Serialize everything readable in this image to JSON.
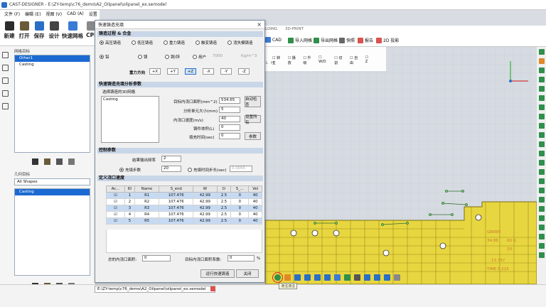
{
  "app": {
    "title": "CAST-DESIGNER - E:\\ZY-temp\\c76_demo\\A2_Oilpanel\\oilpanel_ex.semodel"
  },
  "menu": [
    "文件 (F)",
    "编辑 (E)",
    "视图 (V)",
    "CAD (A)",
    "设置"
  ],
  "toolbar": [
    {
      "label": "新建",
      "color": "#2d2d2d"
    },
    {
      "label": "打开",
      "color": "#6b5a3a"
    },
    {
      "label": "保存",
      "color": "#2a6fc6"
    },
    {
      "label": "设计",
      "color": "#444"
    },
    {
      "label": "快速网格",
      "color": "#3a7bd5"
    },
    {
      "label": "CPI",
      "color": "#888"
    }
  ],
  "ribbon": {
    "tabs": [
      "LDING",
      "3D-PRINT"
    ],
    "items": [
      "CAD",
      "导入网格",
      "导出网格",
      "快照",
      "报告",
      "2D 投影"
    ]
  },
  "left_panel": {
    "mesh_targets_label": "网格目标",
    "mesh_targets": [
      "Other1",
      "Casting"
    ],
    "geometry_targets_label": "几何目标",
    "filter": "All Shapes",
    "shapes": [
      "Casting"
    ]
  },
  "dialog": {
    "title": "快速铸造充填",
    "sec_process": "铸造过程 & 合金",
    "processes": [
      "高压铸造",
      "低压铸造",
      "重力铸造",
      "触变铸造",
      "消失模铸造"
    ],
    "alloys": [
      "铝",
      "镁",
      "铜/锌",
      "用户"
    ],
    "user_val": "7000",
    "user_unit": "Kg/m^3",
    "gravity_label": "重力方向",
    "dirs": [
      "+X",
      "+Y",
      "+Z",
      "-X",
      "-Y",
      "-Z"
    ],
    "sec_analysis": "快速铸造充填分析参数",
    "select_mesh": "选择铸造的3D网格",
    "mesh_item": "Casting",
    "f_gate_area": "目标内浇口面积(mm^2)",
    "v_gate_area": "534.65",
    "btn_auto": "自动检查",
    "f_cell": "分析单元大小(mm)",
    "v_cell": "5",
    "f_speed": "内浇口速度(m/s)",
    "v_speed": "40",
    "btn_setall": "设置所有",
    "f_volume": "铸件体积(L)",
    "v_volume": "0",
    "f_filltime": "填充时间(sec)",
    "v_filltime": "0",
    "btn_params": "参数",
    "sec_control": "控制参数",
    "f_freq": "结果输出频率",
    "v_freq": "2",
    "f_steps": "充填步数",
    "v_steps": "20",
    "f_timestep": "充填时间步长(sec)",
    "v_timestep": "0.0065",
    "sec_gates": "定义浇口速度",
    "cols": [
      "Ac...",
      "ID",
      "Name",
      "S_end",
      "W",
      "D",
      "S_...",
      "Vel"
    ],
    "rows": [
      [
        "1",
        "R1",
        "107.476",
        "42.99",
        "2.5",
        "0",
        "40"
      ],
      [
        "2",
        "R2",
        "107.476",
        "42.99",
        "2.5",
        "0",
        "40"
      ],
      [
        "3",
        "R3",
        "107.476",
        "42.99",
        "2.5",
        "0",
        "40"
      ],
      [
        "4",
        "R4",
        "107.476",
        "42.99",
        "2.5",
        "0",
        "40"
      ],
      [
        "5",
        "R5",
        "107.476",
        "42.99",
        "2.5",
        "0",
        "40"
      ]
    ],
    "f_total_area": "总的内浇口面积:",
    "v_total_area": "0",
    "f_factor": "目标内浇口面积系数:",
    "v_factor": "0",
    "pct": "%",
    "btn_run": "运行快速铸造",
    "btn_close": "关闭"
  },
  "viewport": {
    "ruler": [
      "L",
      "H"
    ],
    "gate_label": "GREEN",
    "numbers": [
      "34.88",
      "00 0.",
      "20 : ",
      "13.737",
      "TIME 0.215"
    ]
  },
  "status": {
    "path": "E:\\ZY-temp\\c76_demo\\A2_Oilpanel\\oilpanel_ex.semodel"
  },
  "tooltip": "浇注浇注"
}
